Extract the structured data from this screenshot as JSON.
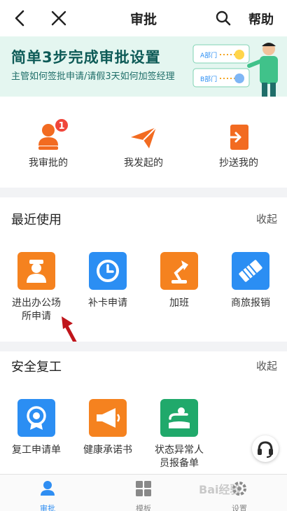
{
  "topbar": {
    "title": "审批",
    "help_label": "帮助",
    "back_icon": "chevron-left-icon",
    "close_icon": "close-icon",
    "search_icon": "search-icon"
  },
  "banner": {
    "title": "简单3步完成审批设置",
    "subtitle": "主管如何签批申请/请假3天如何加签经理",
    "card_a": "A部门",
    "card_b": "B部门",
    "accent": "#0e5b57",
    "background": "#e4f6f0"
  },
  "quick": {
    "items": [
      {
        "label": "我审批的",
        "icon": "approver-person-icon",
        "badge": "1"
      },
      {
        "label": "我发起的",
        "icon": "paper-plane-icon"
      },
      {
        "label": "抄送我的",
        "icon": "cc-document-icon"
      }
    ],
    "icon_color": "#f26b21"
  },
  "recent": {
    "title": "最近使用",
    "collapse_label": "收起",
    "apps": [
      {
        "label": "进出办公场所申请",
        "icon": "guard-person-icon",
        "color": "#f5821f"
      },
      {
        "label": "补卡申请",
        "icon": "clock-icon",
        "color": "#2b8ef3"
      },
      {
        "label": "加班",
        "icon": "desk-lamp-icon",
        "color": "#f5821f"
      },
      {
        "label": "商旅报销",
        "icon": "ticket-icon",
        "color": "#2b8ef3"
      }
    ]
  },
  "safety": {
    "title": "安全复工",
    "collapse_label": "收起",
    "apps": [
      {
        "label": "复工申请单",
        "icon": "badge-medal-icon",
        "color": "#2b8ef3"
      },
      {
        "label": "健康承诺书",
        "icon": "megaphone-icon",
        "color": "#f5821f"
      },
      {
        "label": "状态异常人员报备单",
        "icon": "report-person-icon",
        "color": "#20a96b"
      }
    ]
  },
  "tabbar": {
    "tabs": [
      {
        "label": "审批",
        "icon": "approval-person-icon",
        "active": true
      },
      {
        "label": "模板",
        "icon": "grid-icon",
        "active": false
      },
      {
        "label": "设置",
        "icon": "gear-icon",
        "active": false
      }
    ],
    "active_color": "#2f8ef2"
  },
  "watermark": "Bai经验"
}
